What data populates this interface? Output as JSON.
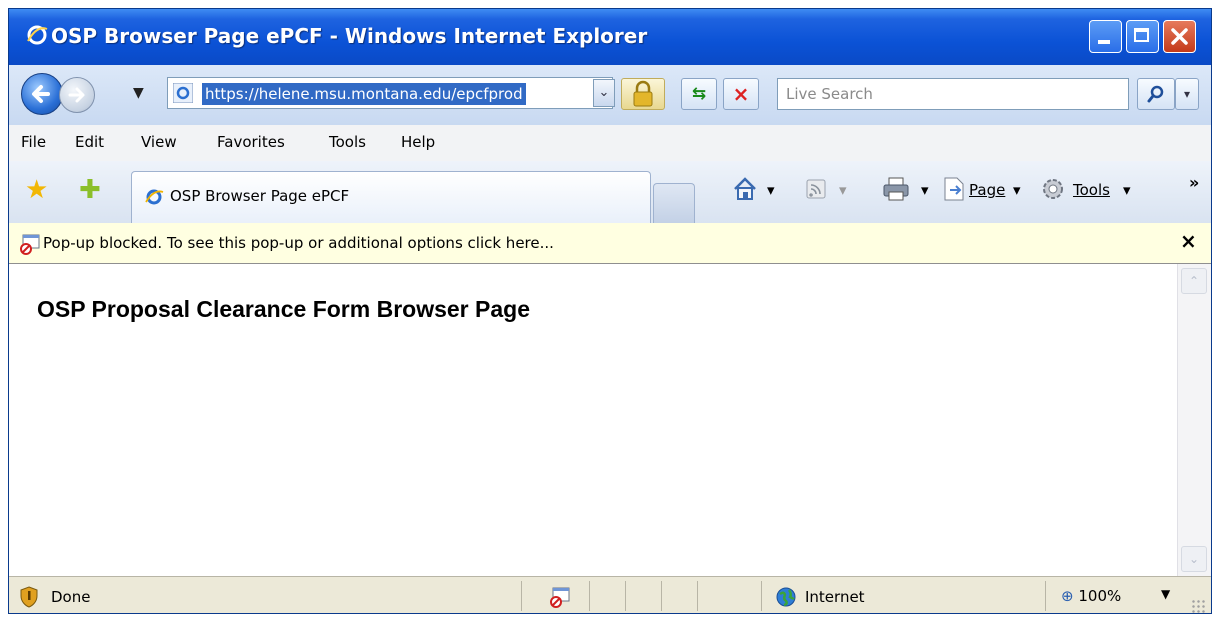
{
  "window": {
    "title": "OSP Browser Page ePCF - Windows Internet Explorer"
  },
  "address": {
    "url": "https://helene.msu.montana.edu/epcfprod"
  },
  "search": {
    "placeholder": "Live Search"
  },
  "menu": {
    "items": [
      "File",
      "Edit",
      "View",
      "Favorites",
      "Tools",
      "Help"
    ]
  },
  "tabs": [
    {
      "label": "OSP Browser Page ePCF"
    }
  ],
  "command_bar": {
    "page_label": "Page",
    "tools_label": "Tools",
    "overflow": "»"
  },
  "infobar": {
    "message": "Pop-up blocked. To see this pop-up or additional options click here...",
    "close": "×"
  },
  "page": {
    "heading": "OSP Proposal Clearance Form Browser Page"
  },
  "status": {
    "text": "Done",
    "zone": "Internet",
    "zoom": "100%"
  },
  "icons": [
    "ie-logo-icon",
    "back-arrow-icon",
    "forward-arrow-icon",
    "lock-icon",
    "refresh-icon",
    "stop-icon",
    "search-icon",
    "favorites-star-icon",
    "add-favorites-icon",
    "home-icon",
    "feeds-icon",
    "print-icon",
    "page-icon",
    "gear-icon",
    "popup-blocked-icon",
    "shield-icon",
    "globe-icon",
    "zoom-icon"
  ],
  "colors": {
    "titlebar": "#0b52d6",
    "url_selection": "#316ac5",
    "infobar": "#ffffe1",
    "statusbar": "#ece9d8"
  }
}
